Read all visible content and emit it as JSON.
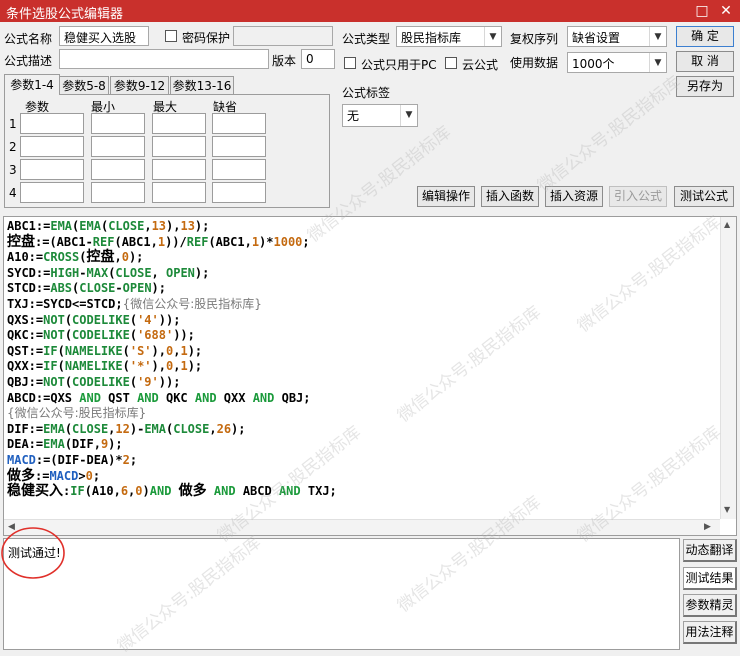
{
  "window": {
    "title": "条件选股公式编辑器",
    "restore_glyph": "□",
    "close_glyph": "✕"
  },
  "form": {
    "name_label": "公式名称",
    "name_value": "稳健买入选股",
    "password_label": "密码保护",
    "desc_label": "公式描述",
    "desc_value": "",
    "version_label": "版本",
    "version_value": "0",
    "type_label": "公式类型",
    "type_value": "股民指标库",
    "fuquan_label": "复权序列",
    "fuquan_value": "缺省设置",
    "pc_only_label": "公式只用于PC",
    "cloud_label": "云公式",
    "data_label": "使用数据",
    "data_value": "1000个",
    "tag_label": "公式标签",
    "tag_value": "无"
  },
  "buttons": {
    "ok": "确  定",
    "cancel": "取  消",
    "save_as": "另存为",
    "edit_ops": "编辑操作",
    "insert_func": "插入函数",
    "insert_res": "插入资源",
    "import_formula": "引入公式",
    "test_formula": "测试公式"
  },
  "tabs": [
    "参数1-4",
    "参数5-8",
    "参数9-12",
    "参数13-16"
  ],
  "param_table": {
    "headers": [
      "参数",
      "最小",
      "最大",
      "缺省"
    ],
    "row_numbers": [
      "1",
      "2",
      "3",
      "4"
    ]
  },
  "code_lines": [
    [
      [
        "ABC1:=",
        ""
      ],
      [
        "EMA",
        "f"
      ],
      [
        "(",
        ""
      ],
      [
        "EMA",
        "f"
      ],
      [
        "(",
        ""
      ],
      [
        "CLOSE",
        "f"
      ],
      [
        ",",
        ""
      ],
      [
        "13",
        "n"
      ],
      [
        "),",
        ""
      ],
      [
        "13",
        "n"
      ],
      [
        ");",
        ""
      ]
    ],
    [
      [
        "控盘",
        "big"
      ],
      [
        ":=(ABC1-",
        ""
      ],
      [
        "REF",
        "f"
      ],
      [
        "(ABC1,",
        ""
      ],
      [
        "1",
        "n"
      ],
      [
        "))/",
        ""
      ],
      [
        "REF",
        "f"
      ],
      [
        "(ABC1,",
        ""
      ],
      [
        "1",
        "n"
      ],
      [
        ")*",
        ""
      ],
      [
        "1000",
        "n"
      ],
      [
        ";",
        ""
      ]
    ],
    [
      [
        "A10:=",
        ""
      ],
      [
        "CROSS",
        "f"
      ],
      [
        "(",
        ""
      ],
      [
        "控盘",
        "big"
      ],
      [
        ",",
        ""
      ],
      [
        "0",
        "n"
      ],
      [
        ");",
        ""
      ]
    ],
    [
      [
        "SYCD:=",
        ""
      ],
      [
        "HIGH",
        "f"
      ],
      [
        "-",
        ""
      ],
      [
        "MAX",
        "f"
      ],
      [
        "(",
        ""
      ],
      [
        "CLOSE",
        "f"
      ],
      [
        ", ",
        ""
      ],
      [
        "OPEN",
        "f"
      ],
      [
        ");",
        ""
      ]
    ],
    [
      [
        "STCD:=",
        ""
      ],
      [
        "ABS",
        "f"
      ],
      [
        "(",
        ""
      ],
      [
        "CLOSE",
        "f"
      ],
      [
        "-",
        ""
      ],
      [
        "OPEN",
        "f"
      ],
      [
        ");",
        ""
      ]
    ],
    [
      [
        "TXJ:=SYCD<=STCD;",
        ""
      ],
      [
        "{微信公众号:股民指标库}",
        "c"
      ]
    ],
    [
      [
        "QXS:=",
        ""
      ],
      [
        "NOT",
        "f"
      ],
      [
        "(",
        ""
      ],
      [
        "CODELIKE",
        "f"
      ],
      [
        "(",
        ""
      ],
      [
        "'4'",
        "n"
      ],
      [
        "));",
        ""
      ]
    ],
    [
      [
        "QKC:=",
        ""
      ],
      [
        "NOT",
        "f"
      ],
      [
        "(",
        ""
      ],
      [
        "CODELIKE",
        "f"
      ],
      [
        "(",
        ""
      ],
      [
        "'688'",
        "n"
      ],
      [
        "));",
        ""
      ]
    ],
    [
      [
        "QST:=",
        ""
      ],
      [
        "IF",
        "f"
      ],
      [
        "(",
        ""
      ],
      [
        "NAMELIKE",
        "f"
      ],
      [
        "(",
        ""
      ],
      [
        "'S'",
        "n"
      ],
      [
        "),",
        ""
      ],
      [
        "0",
        "n"
      ],
      [
        ",",
        ""
      ],
      [
        "1",
        "n"
      ],
      [
        ");",
        ""
      ]
    ],
    [
      [
        "QXX:=",
        ""
      ],
      [
        "IF",
        "f"
      ],
      [
        "(",
        ""
      ],
      [
        "NAMELIKE",
        "f"
      ],
      [
        "(",
        ""
      ],
      [
        "'*'",
        "n"
      ],
      [
        "),",
        ""
      ],
      [
        "0",
        "n"
      ],
      [
        ",",
        ""
      ],
      [
        "1",
        "n"
      ],
      [
        ");",
        ""
      ]
    ],
    [
      [
        "QBJ:=",
        ""
      ],
      [
        "NOT",
        "f"
      ],
      [
        "(",
        ""
      ],
      [
        "CODELIKE",
        "f"
      ],
      [
        "(",
        ""
      ],
      [
        "'9'",
        "n"
      ],
      [
        "));",
        ""
      ]
    ],
    [
      [
        "ABCD:=QXS ",
        ""
      ],
      [
        "AND",
        "k"
      ],
      [
        " QST ",
        ""
      ],
      [
        "AND",
        "k"
      ],
      [
        " QKC ",
        ""
      ],
      [
        "AND",
        "k"
      ],
      [
        " QXX ",
        ""
      ],
      [
        "AND",
        "k"
      ],
      [
        " QBJ;",
        ""
      ]
    ],
    [
      [
        "{微信公众号:股民指标库}",
        "c"
      ]
    ],
    [
      [
        "DIF:=",
        ""
      ],
      [
        "EMA",
        "f"
      ],
      [
        "(",
        ""
      ],
      [
        "CLOSE",
        "f"
      ],
      [
        ",",
        ""
      ],
      [
        "12",
        "n"
      ],
      [
        ")-",
        ""
      ],
      [
        "EMA",
        "f"
      ],
      [
        "(",
        ""
      ],
      [
        "CLOSE",
        "f"
      ],
      [
        ",",
        ""
      ],
      [
        "26",
        "n"
      ],
      [
        ");",
        ""
      ]
    ],
    [
      [
        "DEA:=",
        ""
      ],
      [
        "EMA",
        "f"
      ],
      [
        "(DIF,",
        ""
      ],
      [
        "9",
        "n"
      ],
      [
        ");",
        ""
      ]
    ],
    [
      [
        "MACD",
        "b"
      ],
      [
        ":=(DIF-DEA)*",
        ""
      ],
      [
        "2",
        "n"
      ],
      [
        ";",
        ""
      ]
    ],
    [
      [
        "做多",
        "big"
      ],
      [
        ":=",
        ""
      ],
      [
        "MACD",
        "b"
      ],
      [
        ">",
        ""
      ],
      [
        "0",
        "n"
      ],
      [
        ";",
        ""
      ]
    ],
    [
      [
        "稳健买入",
        "big"
      ],
      [
        ":",
        ""
      ],
      [
        "IF",
        "f"
      ],
      [
        "(A10,",
        ""
      ],
      [
        "6",
        "n"
      ],
      [
        ",",
        ""
      ],
      [
        "0",
        "n"
      ],
      [
        ")",
        ""
      ],
      [
        "AND",
        "k"
      ],
      [
        " ",
        ""
      ],
      [
        "做多",
        "big"
      ],
      [
        " ",
        ""
      ],
      [
        "AND",
        "k"
      ],
      [
        " ABCD ",
        ""
      ],
      [
        "AND",
        "k"
      ],
      [
        " TXJ;",
        ""
      ]
    ]
  ],
  "result": {
    "text": "测试通过!"
  },
  "side_buttons": [
    "动态翻译",
    "测试结果",
    "参数精灵",
    "用法注释"
  ],
  "watermark": "微信公众号:股民指标库",
  "colors": {
    "title_bar": "#c9302c",
    "func": "#1d8a3a",
    "number": "#c46a10",
    "comment": "#7a7a7a",
    "macd": "#1f5fbf",
    "annotation_circle": "#e0302a"
  }
}
